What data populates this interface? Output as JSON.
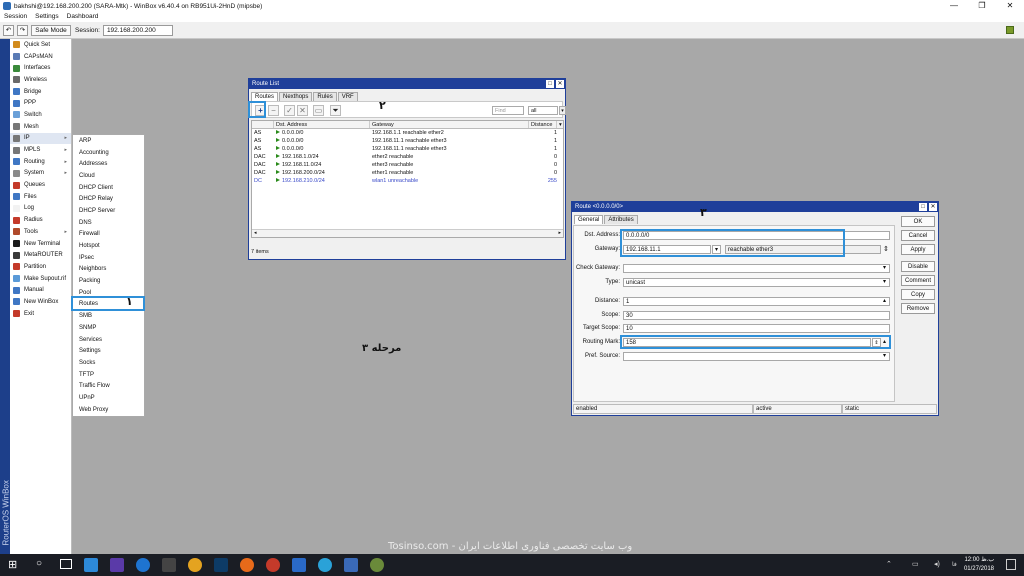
{
  "window": {
    "title": "bakhshi@192.168.200.200 (SARA-Mtk) - WinBox v6.40.4 on RB951Ui-2HnD (mipsbe)",
    "controls": [
      "—",
      "❐",
      "✕"
    ]
  },
  "menubar": [
    "Session",
    "Settings",
    "Dashboard"
  ],
  "toolbar": {
    "undo": "↶",
    "redo": "↷",
    "safe_mode": "Safe Mode",
    "session_label": "Session:",
    "session_value": "192.168.200.200"
  },
  "brand": "RouterOS WinBox",
  "sidebar": [
    {
      "label": "Quick Set",
      "color": "#d28b1c",
      "arrow": ""
    },
    {
      "label": "CAPsMAN",
      "color": "#5a7bb5",
      "arrow": ""
    },
    {
      "label": "Interfaces",
      "color": "#3a8a3a",
      "arrow": ""
    },
    {
      "label": "Wireless",
      "color": "#6a6a6a",
      "arrow": ""
    },
    {
      "label": "Bridge",
      "color": "#3f77c4",
      "arrow": ""
    },
    {
      "label": "PPP",
      "color": "#3f77c4",
      "arrow": ""
    },
    {
      "label": "Switch",
      "color": "#6aa0d8",
      "arrow": ""
    },
    {
      "label": "Mesh",
      "color": "#777777",
      "arrow": ""
    },
    {
      "label": "IP",
      "color": "#777777",
      "arrow": "▸"
    },
    {
      "label": "MPLS",
      "color": "#777777",
      "arrow": "▸"
    },
    {
      "label": "Routing",
      "color": "#3f77c4",
      "arrow": "▸"
    },
    {
      "label": "System",
      "color": "#8a8a8a",
      "arrow": "▸"
    },
    {
      "label": "Queues",
      "color": "#c43a2a",
      "arrow": ""
    },
    {
      "label": "Files",
      "color": "#3f77c4",
      "arrow": ""
    },
    {
      "label": "Log",
      "color": "#f2f2f2",
      "arrow": ""
    },
    {
      "label": "Radius",
      "color": "#c43a2a",
      "arrow": ""
    },
    {
      "label": "Tools",
      "color": "#b04a2a",
      "arrow": "▸"
    },
    {
      "label": "New Terminal",
      "color": "#1a1a1a",
      "arrow": ""
    },
    {
      "label": "MetaROUTER",
      "color": "#3a3a3a",
      "arrow": ""
    },
    {
      "label": "Partition",
      "color": "#c43a2a",
      "arrow": ""
    },
    {
      "label": "Make Supout.rif",
      "color": "#5a9ad8",
      "arrow": ""
    },
    {
      "label": "Manual",
      "color": "#3f77c4",
      "arrow": ""
    },
    {
      "label": "New WinBox",
      "color": "#3f77c4",
      "arrow": ""
    },
    {
      "label": "Exit",
      "color": "#c43a2a",
      "arrow": ""
    }
  ],
  "ip_submenu": [
    "ARP",
    "Accounting",
    "Addresses",
    "Cloud",
    "DHCP Client",
    "DHCP Relay",
    "DHCP Server",
    "DNS",
    "Firewall",
    "Hotspot",
    "IPsec",
    "Neighbors",
    "Packing",
    "Pool",
    "Routes",
    "SMB",
    "SNMP",
    "Services",
    "Settings",
    "Socks",
    "TFTP",
    "Traffic Flow",
    "UPnP",
    "Web Proxy"
  ],
  "annotations": {
    "step1": "۱",
    "step2": "۲",
    "step3": "۳",
    "caption": "مرحله ۳"
  },
  "route_list": {
    "title": "Route List",
    "tabs": [
      "Routes",
      "Nexthops",
      "Rules",
      "VRF"
    ],
    "find_placeholder": "Find",
    "filter_value": "all",
    "columns": [
      "",
      "Dst. Address",
      "Gateway",
      "Distance"
    ],
    "rows": [
      {
        "flags": "AS",
        "dst": "0.0.0.0/0",
        "gateway": "192.168.1.1 reachable ether2",
        "distance": "1",
        "color": "#111111"
      },
      {
        "flags": "AS",
        "dst": "0.0.0.0/0",
        "gateway": "192.168.11.1 reachable ether3",
        "distance": "1",
        "color": "#111111"
      },
      {
        "flags": "AS",
        "dst": "0.0.0.0/0",
        "gateway": "192.168.11.1 reachable ether3",
        "distance": "1",
        "color": "#111111"
      },
      {
        "flags": "DAC",
        "dst": "192.168.1.0/24",
        "gateway": "ether2 reachable",
        "distance": "0",
        "color": "#111111"
      },
      {
        "flags": "DAC",
        "dst": "192.168.11.0/24",
        "gateway": "ether3 reachable",
        "distance": "0",
        "color": "#111111"
      },
      {
        "flags": "DAC",
        "dst": "192.168.200.0/24",
        "gateway": "ether1 reachable",
        "distance": "0",
        "color": "#111111"
      },
      {
        "flags": "DC",
        "dst": "192.168.210.0/24",
        "gateway": "wlan1 unreachable",
        "distance": "255",
        "color": "#3a4ac8"
      }
    ],
    "status": "7 items"
  },
  "route_editor": {
    "title": "Route <0.0.0.0/0>",
    "tabs": [
      "General",
      "Attributes"
    ],
    "fields": {
      "dst_label": "Dst. Address:",
      "dst_value": "0.0.0.0/0",
      "gateway_label": "Gateway:",
      "gateway_value": "192.168.11.1",
      "gateway_status": "reachable ether3",
      "check_gateway_label": "Check Gateway:",
      "check_gateway_value": "",
      "type_label": "Type:",
      "type_value": "unicast",
      "distance_label": "Distance:",
      "distance_value": "1",
      "scope_label": "Scope:",
      "scope_value": "30",
      "target_scope_label": "Target Scope:",
      "target_scope_value": "10",
      "routing_mark_label": "Routing Mark:",
      "routing_mark_value": "158",
      "pref_source_label": "Pref. Source:",
      "pref_source_value": ""
    },
    "buttons": [
      "OK",
      "Cancel",
      "Apply",
      "Disable",
      "Comment",
      "Copy",
      "Remove"
    ],
    "status": [
      "enabled",
      "active",
      "static"
    ]
  },
  "watermark": "Tosinso.com - وب سایت تخصصی فناوری اطلاعات ایران",
  "taskbar": {
    "lang": "فا",
    "time": "12:00 ب.ظ",
    "date": "01/27/2018"
  }
}
